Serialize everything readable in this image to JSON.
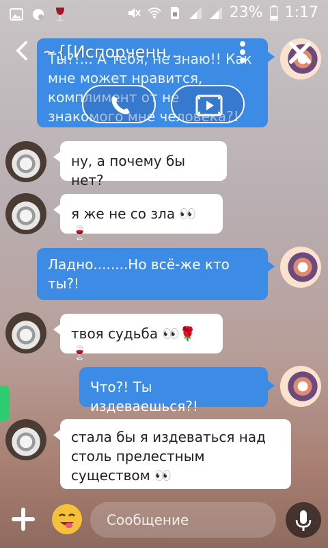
{
  "statusbar": {
    "battery": "23%",
    "time": "1:17",
    "icons": [
      "image-icon",
      "chat-bubble-icon",
      "wine-glass-icon",
      "mute-icon",
      "wifi-icon",
      "sim-icon",
      "signal-icon",
      "battery-icon"
    ]
  },
  "header": {
    "title": "~{[Испорченн...",
    "icons": [
      "back-arrow-icon",
      "more-vert-icon",
      "close-icon"
    ]
  },
  "call_buttons": {
    "icons": [
      "voice-call-icon",
      "video-icon"
    ]
  },
  "messages": [
    {
      "side": "out",
      "text": "Ты?!... А тебя, не знаю!! Как мне может нравится, комплимент от не знакомого мне человека?!"
    },
    {
      "side": "in",
      "text": "ну, а почему бы нет?"
    },
    {
      "side": "in",
      "text": "я же не со зла 👀🍷"
    },
    {
      "side": "out",
      "text": "Ладно........Но всё-же кто ты?!"
    },
    {
      "side": "in",
      "text": "твоя судьба 👀🌹🍷"
    },
    {
      "side": "out",
      "text": "Что?! Ты издеваешься?!"
    },
    {
      "side": "in",
      "text": "стала бы я издеваться над столь прелестным существом 👀"
    }
  ],
  "composer": {
    "placeholder": "Сообщение",
    "icons": [
      "add-icon",
      "emoji-icon",
      "mic-icon"
    ]
  },
  "colors": {
    "outgoing_bubble": "#3c8ce6",
    "incoming_bubble": "#ffffff",
    "side_tab": "#2ecc71"
  }
}
